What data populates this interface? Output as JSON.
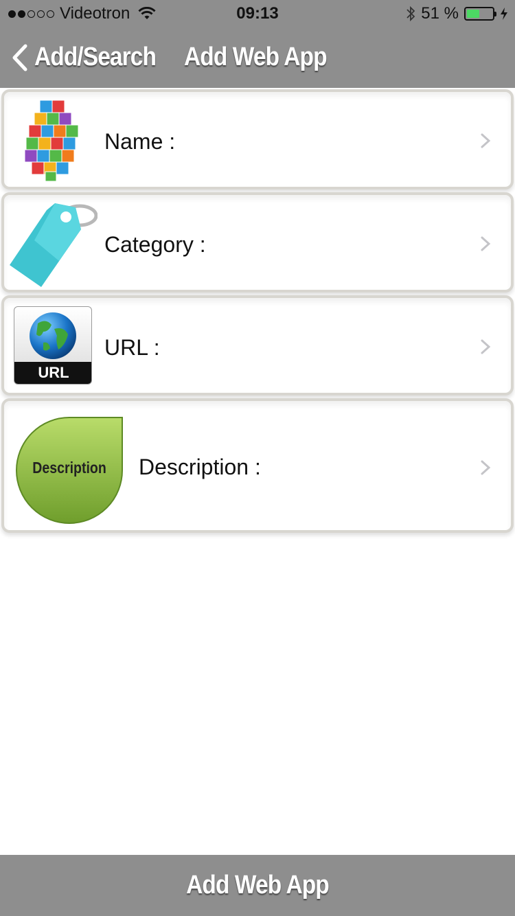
{
  "status_bar": {
    "carrier": "Videotron",
    "time": "09:13",
    "battery_text": "51 %",
    "battery_level": 0.51
  },
  "nav": {
    "back_label": "Add/Search",
    "title": "Add Web App"
  },
  "rows": [
    {
      "label": "Name :",
      "icon": "app-cubes-icon"
    },
    {
      "label": "Category :",
      "icon": "tag-icon"
    },
    {
      "label": "URL :",
      "icon": "url-globe-icon",
      "icon_text": "URL"
    },
    {
      "label": "Description :",
      "icon": "description-leaf-icon",
      "icon_text": "Description"
    }
  ],
  "footer": {
    "button_label": "Add Web App"
  },
  "colors": {
    "bar": "#8e8e8e",
    "battery": "#4cd964",
    "row_border": "#d8d6d0"
  }
}
